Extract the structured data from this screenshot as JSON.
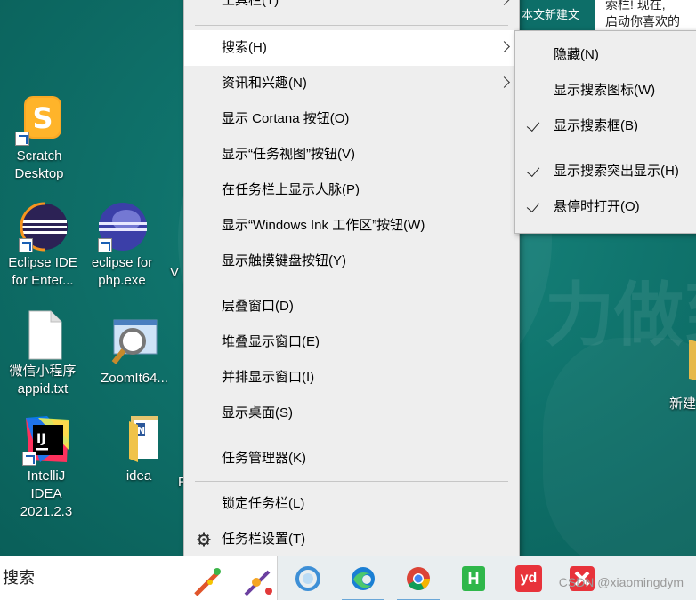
{
  "desktop": {
    "icons": [
      {
        "id": "scratch",
        "line1": "Scratch",
        "line2": "Desktop"
      },
      {
        "id": "eclipse-ide",
        "line1": "Eclipse IDE",
        "line2": "for Enter..."
      },
      {
        "id": "eclipse-php",
        "line1": "eclipse for",
        "line2": "php.exe"
      },
      {
        "id": "wechat-mini",
        "line1": "微信小程序",
        "line2": "appid.txt"
      },
      {
        "id": "zoomit",
        "line1": "ZoomIt64...",
        "line2": ""
      },
      {
        "id": "intellij",
        "line1": "IntelliJ IDEA",
        "line2": "2021.2.3"
      },
      {
        "id": "idea-folder",
        "line1": "idea",
        "line2": ""
      },
      {
        "id": "new-folder",
        "line1": "新建",
        "line2": ""
      }
    ],
    "partial_labels": {
      "v": "V",
      "r": "R"
    },
    "background_text": "力做到",
    "article": {
      "tag": "本文新建文",
      "line1": "索栏! 现在, ",
      "line2": "启动你喜欢的"
    }
  },
  "context_menu": {
    "items": [
      {
        "label": "工具栏(T)",
        "has_submenu": true
      },
      {
        "label": "搜索(H)",
        "has_submenu": true,
        "highlighted": true
      },
      {
        "label": "资讯和兴趣(N)",
        "has_submenu": true
      },
      {
        "label": "显示 Cortana 按钮(O)"
      },
      {
        "label": "显示“任务视图”按钮(V)"
      },
      {
        "label": "在任务栏上显示人脉(P)"
      },
      {
        "label": "显示“Windows Ink 工作区”按钮(W)"
      },
      {
        "label": "显示触摸键盘按钮(Y)"
      },
      {
        "label": "层叠窗口(D)"
      },
      {
        "label": "堆叠显示窗口(E)"
      },
      {
        "label": "并排显示窗口(I)"
      },
      {
        "label": "显示桌面(S)"
      },
      {
        "label": "任务管理器(K)"
      },
      {
        "label": "锁定任务栏(L)"
      },
      {
        "label": "任务栏设置(T)",
        "icon": "gear-icon"
      }
    ]
  },
  "search_submenu": {
    "items": [
      {
        "label": "隐藏(N)",
        "checked": false
      },
      {
        "label": "显示搜索图标(W)",
        "checked": false
      },
      {
        "label": "显示搜索框(B)",
        "checked": true
      },
      {
        "label": "显示搜索突出显示(H)",
        "checked": true
      },
      {
        "label": "悬停时打开(O)",
        "checked": true
      }
    ]
  },
  "taskbar": {
    "search_placeholder": "搜索",
    "apps": [
      "cortana-icon",
      "edge-icon",
      "chrome-icon",
      "hbuilder-icon",
      "youdao-icon",
      "xmind-icon"
    ],
    "hbuilder_glyph": "H",
    "youdao_glyph": "yd",
    "watermark": "CSDN @xiaomingdym"
  },
  "colors": {
    "desktop": "#0f726b",
    "menu_bg": "#eeeeee",
    "menu_highlight": "#ffffff",
    "taskbar": "#e9eef0"
  }
}
